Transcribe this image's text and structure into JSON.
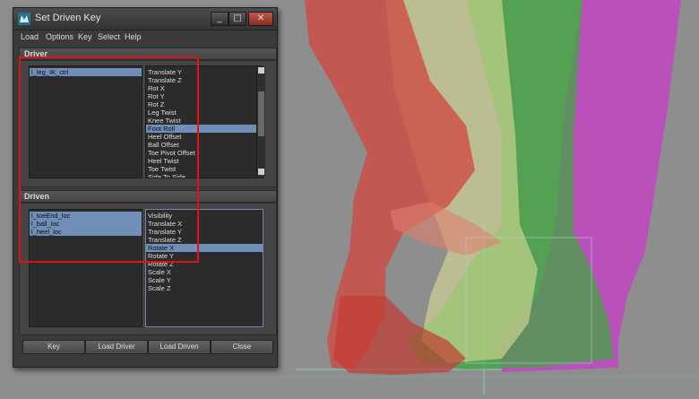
{
  "window": {
    "title": "Set Driven Key"
  },
  "window_controls": {
    "minimize": "_",
    "maximize": "□",
    "close": "✕"
  },
  "menu": [
    "Load",
    "Options",
    "Key",
    "Select",
    "Help"
  ],
  "driver": {
    "header": "Driver",
    "objects": [
      {
        "label": "l_leg_IK_ctrl",
        "selected": true
      }
    ],
    "attributes": [
      {
        "label": "Translate Y",
        "selected": false
      },
      {
        "label": "Translate Z",
        "selected": false
      },
      {
        "label": "Rot X",
        "selected": false
      },
      {
        "label": "Rot Y",
        "selected": false
      },
      {
        "label": "Rot Z",
        "selected": false
      },
      {
        "label": "Leg Twist",
        "selected": false
      },
      {
        "label": "Knee Twist",
        "selected": false
      },
      {
        "label": "Foot Roll",
        "selected": true
      },
      {
        "label": "Heel Offset",
        "selected": false
      },
      {
        "label": "Ball Offset",
        "selected": false
      },
      {
        "label": "Toe Pivot Offset",
        "selected": false
      },
      {
        "label": "Heel Twist",
        "selected": false
      },
      {
        "label": "Toe Twist",
        "selected": false
      },
      {
        "label": "Side To Side",
        "selected": false
      }
    ]
  },
  "driven": {
    "header": "Driven",
    "objects": [
      {
        "label": "l_toeEnd_loc",
        "selected": true
      },
      {
        "label": "l_ball_loc",
        "selected": true
      },
      {
        "label": "l_heel_loc",
        "selected": true
      }
    ],
    "attributes": [
      {
        "label": "Visibility",
        "selected": false
      },
      {
        "label": "Translate X",
        "selected": false
      },
      {
        "label": "Translate Y",
        "selected": false
      },
      {
        "label": "Translate Z",
        "selected": false
      },
      {
        "label": "Rotate X",
        "selected": true
      },
      {
        "label": "Rotate Y",
        "selected": false
      },
      {
        "label": "Rotate Z",
        "selected": false
      },
      {
        "label": "Scale X",
        "selected": false
      },
      {
        "label": "Scale Y",
        "selected": false
      },
      {
        "label": "Scale Z",
        "selected": false
      }
    ]
  },
  "buttons": {
    "key": "Key",
    "load_driver": "Load Driver",
    "load_driven": "Load Driven",
    "close": "Close"
  },
  "colors": {
    "selection": "#6f8fb8",
    "annotation_box": "#e01212",
    "leg_red": "#d2463c",
    "leg_yellow": "#dcdc96",
    "leg_green": "#3caa3c",
    "leg_magenta": "#c83cc8"
  },
  "icons": {
    "app": "maya-app-icon"
  }
}
